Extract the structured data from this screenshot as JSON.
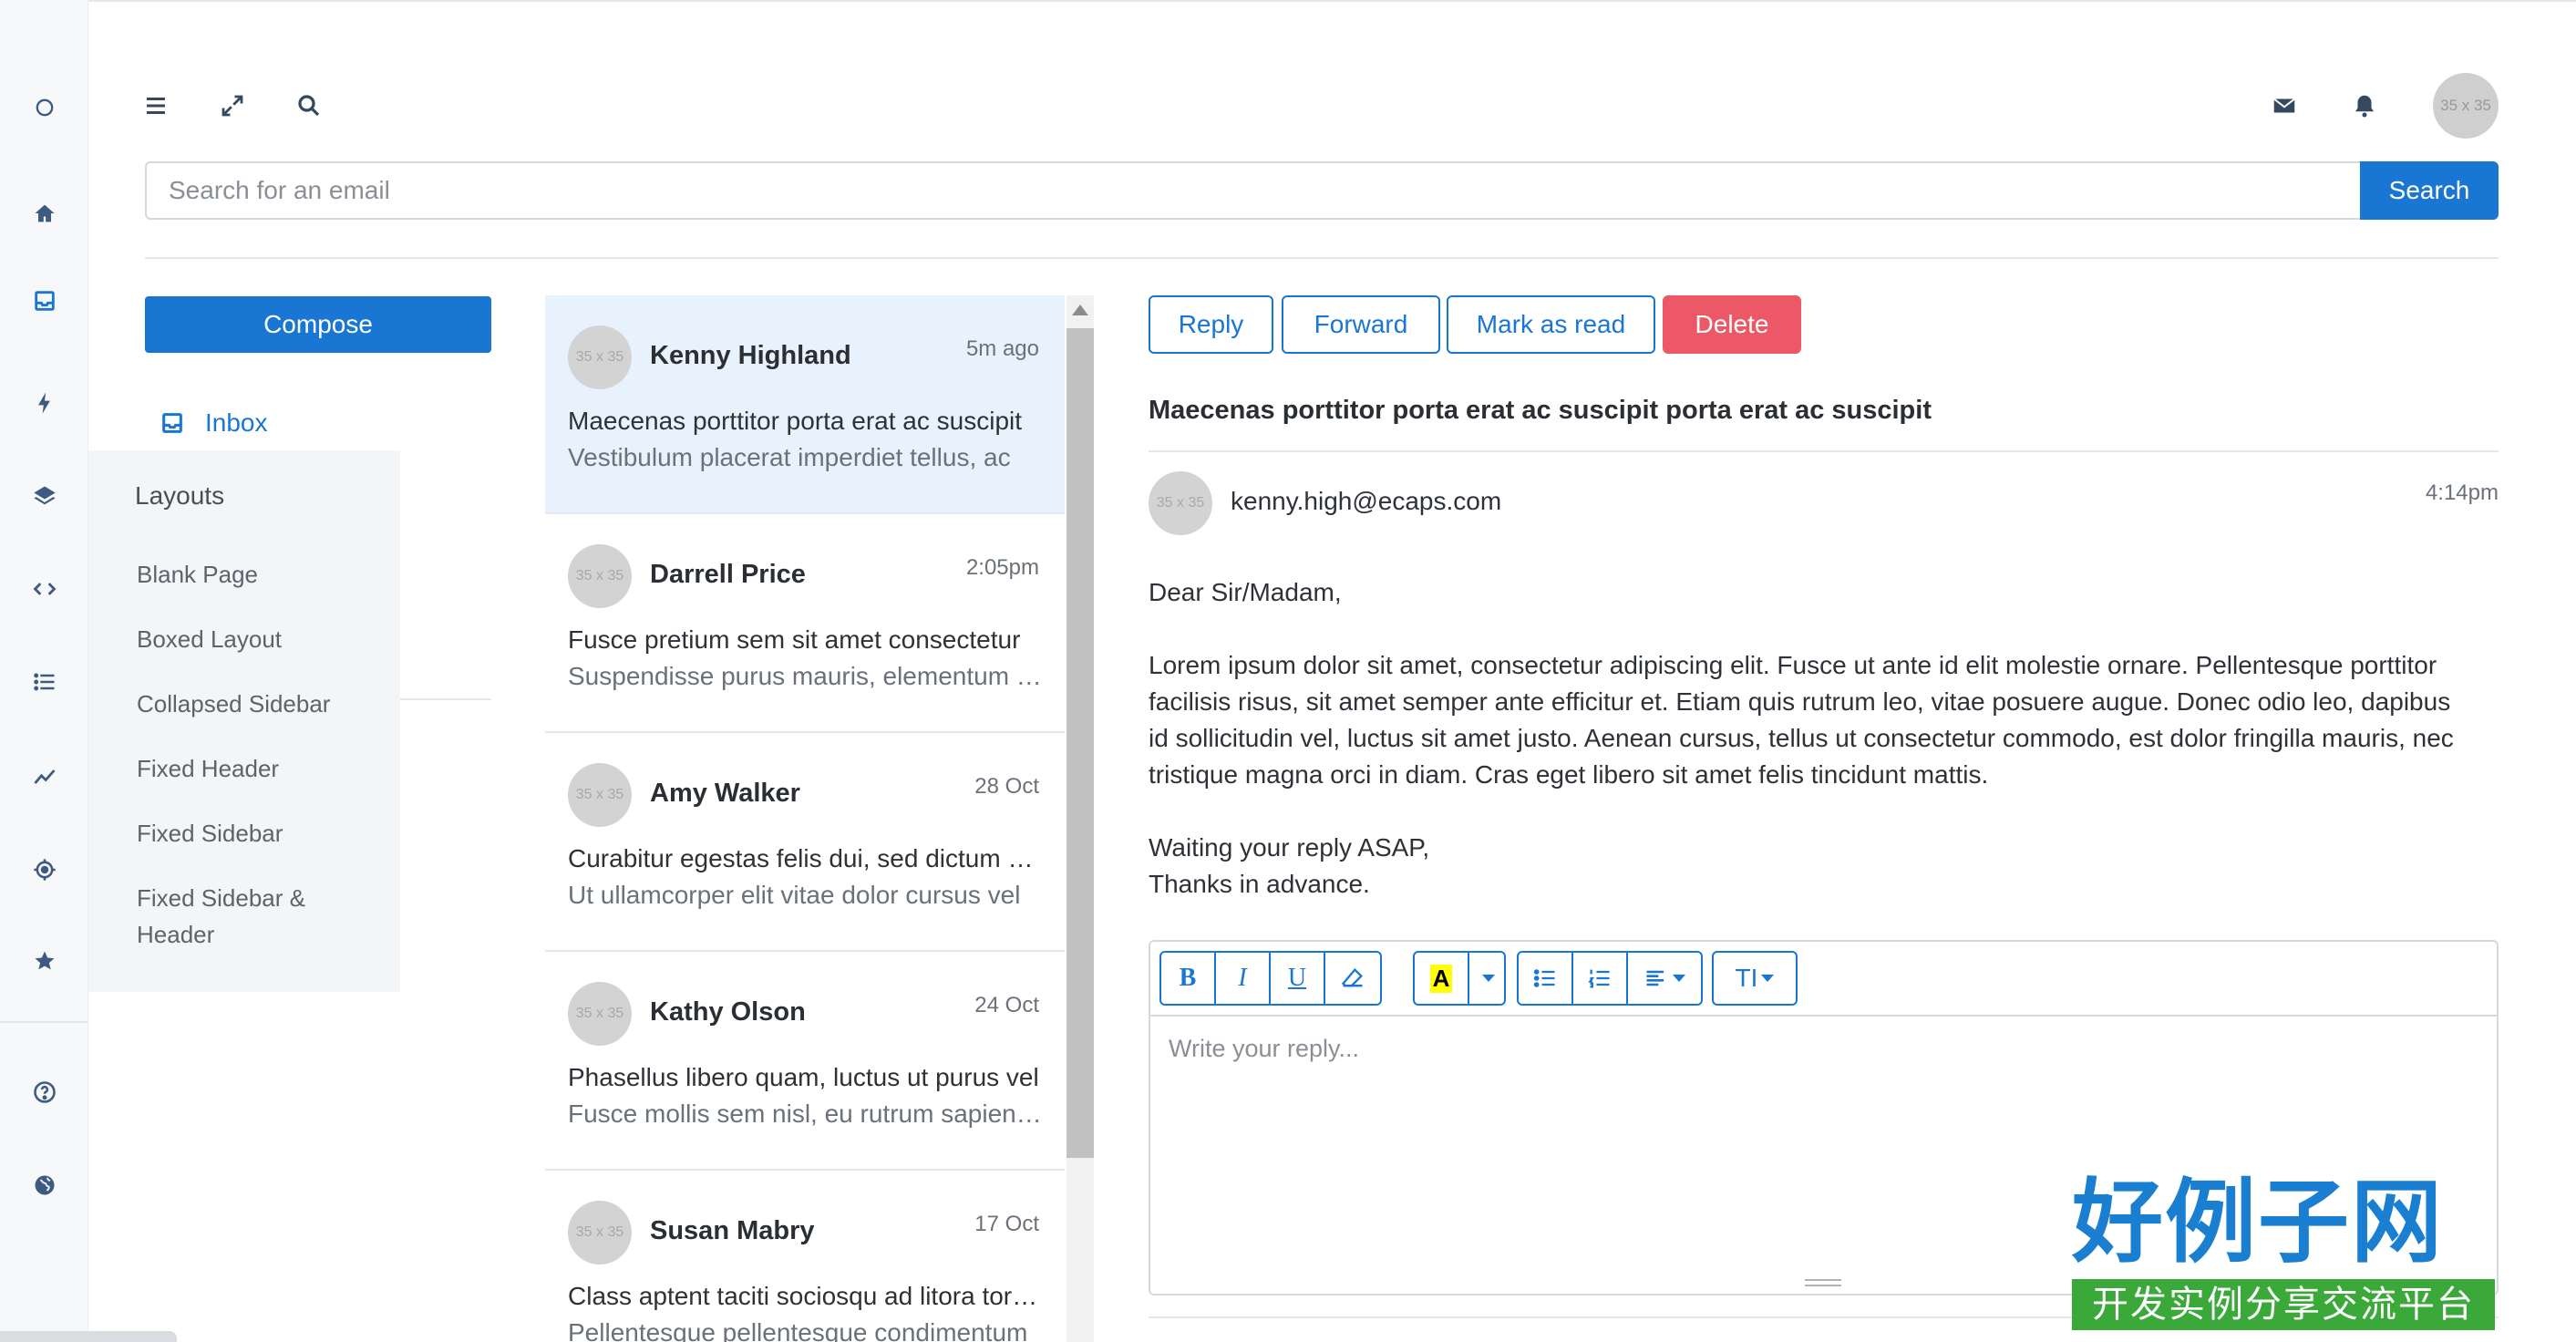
{
  "top": {
    "search_placeholder": "Search for an email",
    "search_button": "Search",
    "avatar_text": "35 x 35"
  },
  "left": {
    "compose_label": "Compose",
    "inbox_label": "Inbox"
  },
  "flyout": {
    "heading": "Layouts",
    "items": [
      "Blank Page",
      "Boxed Layout",
      "Collapsed Sidebar",
      "Fixed Header",
      "Fixed Sidebar",
      "Fixed Sidebar &",
      "Header"
    ]
  },
  "mails": [
    {
      "name": "Kenny Highland",
      "time": "5m ago",
      "subject": "Maecenas porttitor porta erat ac suscipit",
      "preview": "Vestibulum placerat imperdiet tellus, ac",
      "avatar": "35 x 35"
    },
    {
      "name": "Darrell Price",
      "time": "2:05pm",
      "subject": "Fusce pretium sem sit amet consectetur",
      "preview": "Suspendisse purus mauris, elementum vel",
      "avatar": "35 x 35"
    },
    {
      "name": "Amy Walker",
      "time": "28 Oct",
      "subject": "Curabitur egestas felis dui, sed dictum nisl",
      "preview": "Ut ullamcorper elit vitae dolor cursus vel",
      "avatar": "35 x 35"
    },
    {
      "name": "Kathy Olson",
      "time": "24 Oct",
      "subject": "Phasellus libero quam, luctus ut purus vel",
      "preview": "Fusce mollis sem nisl, eu rutrum sapien et",
      "avatar": "35 x 35"
    },
    {
      "name": "Susan Mabry",
      "time": "17 Oct",
      "subject": "Class aptent taciti sociosqu ad litora torquent",
      "preview": "Pellentesque pellentesque condimentum",
      "avatar": "35 x 35"
    }
  ],
  "reader": {
    "actions": {
      "reply": "Reply",
      "forward": "Forward",
      "mark_read": "Mark as read",
      "delete": "Delete"
    },
    "subject": "Maecenas porttitor porta erat ac suscipit porta erat ac suscipit",
    "from_email": "kenny.high@ecaps.com",
    "time": "4:14pm",
    "avatar": "35 x 35",
    "greeting": "Dear Sir/Madam,",
    "body_lines": [
      "Lorem ipsum dolor sit amet, consectetur adipiscing elit. Fusce ut ante id elit molestie ornare. Pellentesque porttitor",
      "facilisis risus, sit amet semper ante efficitur et. Etiam quis rutrum leo, vitae posuere augue. Donec odio leo, dapibus",
      "id sollicitudin vel, luctus sit amet justo. Aenean cursus, tellus ut consectetur commodo, est dolor fringilla mauris, nec",
      "tristique magna orci in diam. Cras eget libero sit amet felis tincidunt mattis."
    ],
    "closing_1": "Waiting your reply ASAP,",
    "closing_2": "Thanks in advance."
  },
  "editor": {
    "bold": "B",
    "italic": "I",
    "underline": "U",
    "highlight": "A",
    "text_size": "TI",
    "placeholder": "Write your reply..."
  },
  "watermark": {
    "top": "好例子网",
    "bottom": "开发实例分享交流平台"
  },
  "colors": {
    "primary": "#1976d2",
    "danger": "#ec5865",
    "active_row": "#e8f2fd"
  },
  "icons": {
    "rail": [
      "circle-icon",
      "home-icon",
      "inbox-icon",
      "bolt-icon",
      "layers-icon",
      "code-icon",
      "list-icon",
      "chart-line-icon",
      "target-icon",
      "star-icon",
      "help-icon",
      "globe-icon"
    ],
    "toolbar": [
      "menu-icon",
      "expand-icon",
      "search-icon",
      "mail-icon",
      "bell-icon"
    ]
  }
}
